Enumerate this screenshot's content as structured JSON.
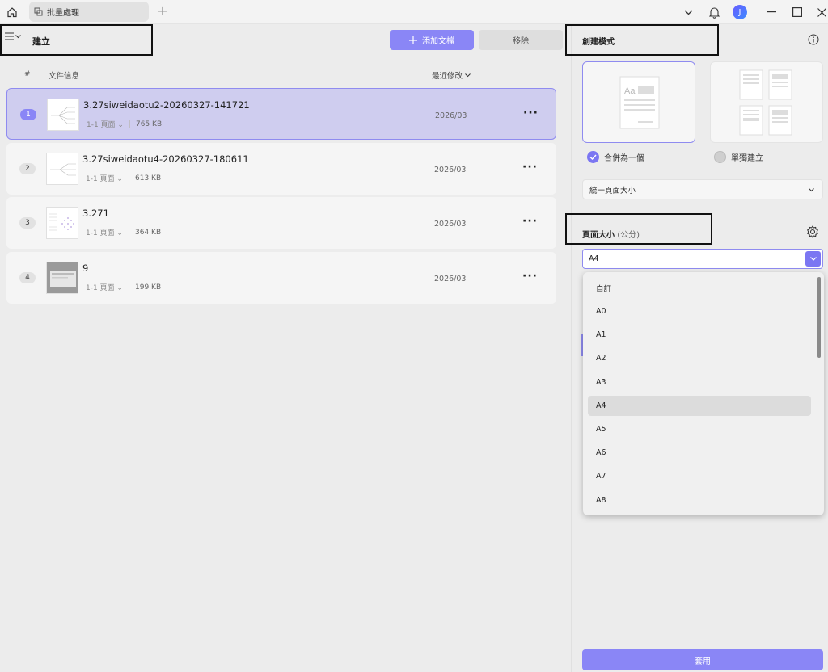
{
  "titlebar": {
    "tab_title": "批量處理",
    "avatar_letter": "J"
  },
  "left": {
    "section_title": "建立",
    "add_button": "添加文檔",
    "remove_button": "移除",
    "columns": {
      "hash": "#",
      "info": "文件信息",
      "modified": "最近修改"
    },
    "files": [
      {
        "num": "1",
        "name": "3.27siweidaotu2-20260327-141721",
        "pages": "1-1 頁面",
        "size": "765 KB",
        "date": "2026/03",
        "selected": true
      },
      {
        "num": "2",
        "name": "3.27siweidaotu4-20260327-180611",
        "pages": "1-1 頁面",
        "size": "613 KB",
        "date": "2026/03",
        "selected": false
      },
      {
        "num": "3",
        "name": "3.271",
        "pages": "1-1 頁面",
        "size": "364 KB",
        "date": "2026/03",
        "selected": false
      },
      {
        "num": "4",
        "name": "9",
        "pages": "1-1 頁面",
        "size": "199 KB",
        "date": "2026/03",
        "selected": false
      }
    ]
  },
  "right": {
    "mode_title": "創建模式",
    "option_merge": "合併為一個",
    "option_single": "單獨建立",
    "uniform_select": "統一頁面大小",
    "page_size_title": "頁面大小",
    "page_size_unit": "(公分)",
    "page_size_value": "A4",
    "dropdown_options": [
      "自訂",
      "A0",
      "A1",
      "A2",
      "A3",
      "A4",
      "A5",
      "A6",
      "A7",
      "A8"
    ],
    "highlighted_option": "A4",
    "apply_button": "套用"
  },
  "colors": {
    "accent": "#8a86f6",
    "selected_row": "#cfcdef"
  }
}
